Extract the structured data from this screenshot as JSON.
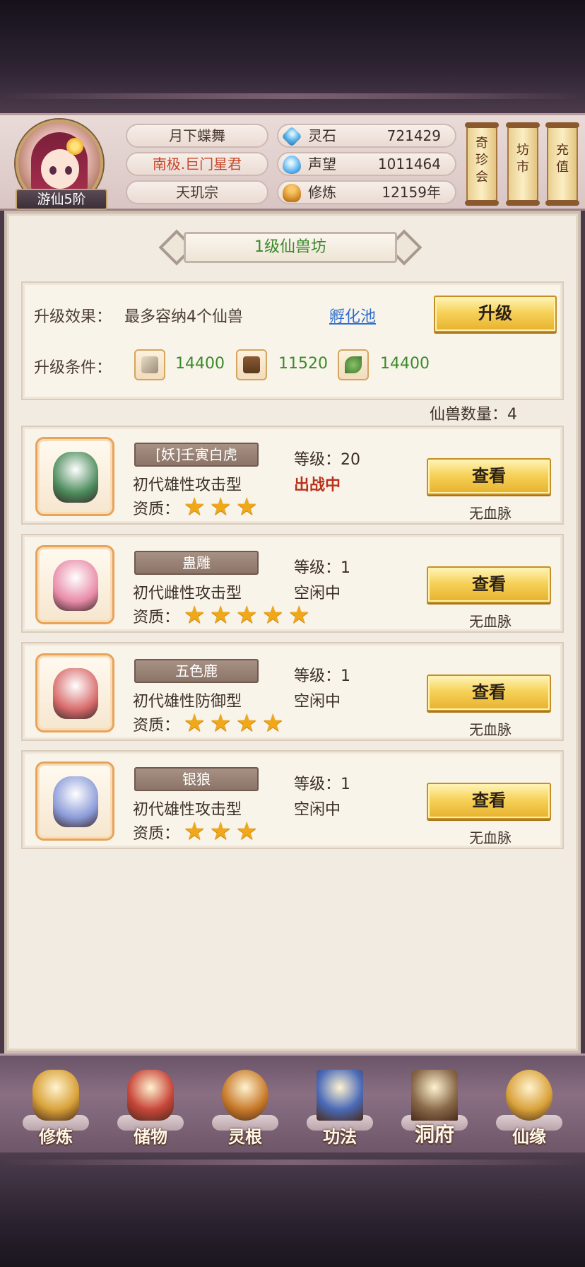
{
  "header": {
    "rank": "游仙5阶",
    "player_name": "月下蝶舞",
    "title": "南极.巨门星君",
    "sect": "天玑宗",
    "stats": [
      {
        "label": "灵石",
        "value": "721429",
        "icon": "spirit-stone-icon"
      },
      {
        "label": "声望",
        "value": "1011464",
        "icon": "reputation-icon"
      },
      {
        "label": "修炼",
        "value": "12159年",
        "icon": "cultivation-icon"
      }
    ],
    "side_buttons": [
      "奇\n珍\n会",
      "坊\n市",
      "充\n值"
    ]
  },
  "workshop": {
    "title": "1级仙兽坊",
    "effect_label": "升级效果：",
    "effect_text": "最多容纳4个仙兽",
    "hatch_link": "孵化池",
    "upgrade_button": "升级",
    "condition_label": "升级条件：",
    "materials": [
      {
        "icon": "crystal-bundle-icon",
        "amount": "14400"
      },
      {
        "icon": "wood-log-icon",
        "amount": "11520"
      },
      {
        "icon": "herb-leaf-icon",
        "amount": "14400"
      }
    ],
    "count_text": "仙兽数量：4"
  },
  "pets": [
    {
      "name": "[妖]壬寅白虎",
      "desc": "初代雄性攻击型",
      "quality_label": "资质：",
      "stars": 3,
      "level": "等级：20",
      "status": "出战中",
      "fighting": true,
      "button": "查看",
      "bloodline": "无血脉",
      "art_color": "#4a8a5a"
    },
    {
      "name": "蛊雕",
      "desc": "初代雌性攻击型",
      "quality_label": "资质：",
      "stars": 5,
      "level": "等级：1",
      "status": "空闲中",
      "fighting": false,
      "button": "查看",
      "bloodline": "无血脉",
      "art_color": "#e88aa8"
    },
    {
      "name": "五色鹿",
      "desc": "初代雄性防御型",
      "quality_label": "资质：",
      "stars": 4,
      "level": "等级：1",
      "status": "空闲中",
      "fighting": false,
      "button": "查看",
      "bloodline": "无血脉",
      "art_color": "#d86a6a"
    },
    {
      "name": "银狼",
      "desc": "初代雄性攻击型",
      "quality_label": "资质：",
      "stars": 3,
      "level": "等级：1",
      "status": "空闲中",
      "fighting": false,
      "button": "查看",
      "bloodline": "无血脉",
      "art_color": "#8a9ad8"
    }
  ],
  "nav": [
    {
      "label": "修炼",
      "icon": "cultivation-figure-icon",
      "color": "#d9a23a"
    },
    {
      "label": "储物",
      "icon": "storage-bag-icon",
      "color": "#c8463a"
    },
    {
      "label": "灵根",
      "icon": "spirit-root-icon",
      "color": "#c87a2a"
    },
    {
      "label": "功法",
      "icon": "skill-book-icon",
      "color": "#4a6ab8"
    },
    {
      "label": "洞府",
      "icon": "cave-mansion-icon",
      "color": "#8a6a4a"
    },
    {
      "label": "仙缘",
      "icon": "immortal-fate-icon",
      "color": "#d9a23a"
    }
  ]
}
